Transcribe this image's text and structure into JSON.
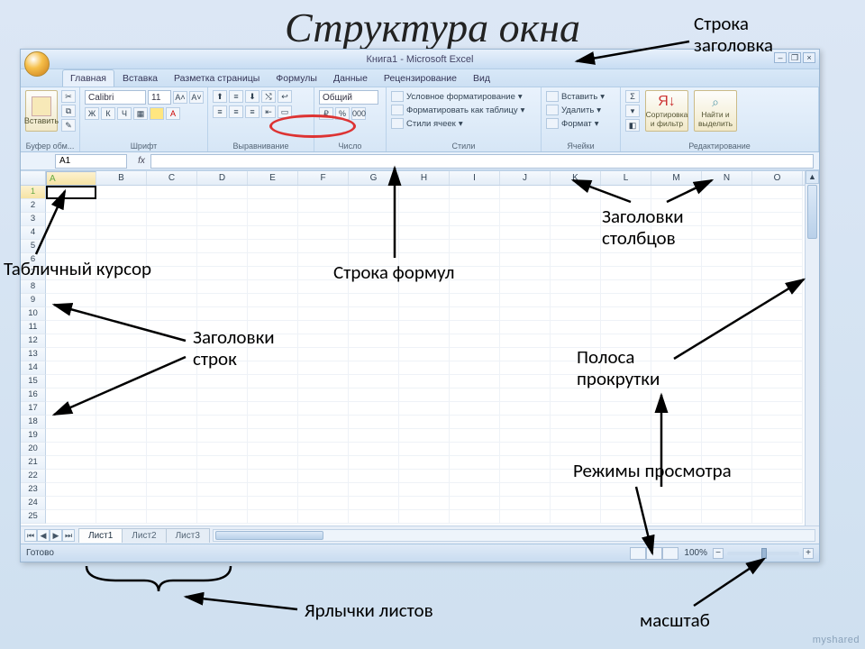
{
  "slide": {
    "title": "Структура окна"
  },
  "window_title": "Книга1 - Microsoft Excel",
  "tabs": {
    "home": "Главная",
    "insert": "Вставка",
    "layout": "Разметка страницы",
    "formulas": "Формулы",
    "data": "Данные",
    "review": "Рецензирование",
    "view": "Вид"
  },
  "ribbon": {
    "paste": "Вставить",
    "clipboard_group": "Буфер обм...",
    "font_name": "Calibri",
    "font_size": "11",
    "font_group": "Шрифт",
    "align_group": "Выравнивание",
    "number_fmt": "Общий",
    "number_group": "Число",
    "cond_fmt": "Условное форматирование",
    "fmt_table": "Форматировать как таблицу",
    "cell_styles": "Стили ячеек",
    "styles_group": "Стили",
    "ins": "Вставить",
    "del": "Удалить",
    "fmt": "Формат",
    "cells_group": "Ячейки",
    "sort": "Сортировка\nи фильтр",
    "find": "Найти и\nвыделить",
    "edit_group": "Редактирование",
    "b": "Ж",
    "i": "К",
    "u": "Ч"
  },
  "namebox": "A1",
  "fx": "fx",
  "columns": [
    "A",
    "B",
    "C",
    "D",
    "E",
    "F",
    "G",
    "H",
    "I",
    "J",
    "K",
    "L",
    "M",
    "N",
    "O"
  ],
  "rows": [
    "1",
    "2",
    "3",
    "4",
    "5",
    "6",
    "7",
    "8",
    "9",
    "10",
    "11",
    "12",
    "13",
    "14",
    "15",
    "16",
    "17",
    "18",
    "19",
    "20",
    "21",
    "22",
    "23",
    "24",
    "25"
  ],
  "sheets": {
    "s1": "Лист1",
    "s2": "Лист2",
    "s3": "Лист3"
  },
  "status": {
    "ready": "Готово",
    "zoom": "100%"
  },
  "callouts": {
    "titlebar": "Строка\nзаголовка",
    "cursor": "Табличный курсор",
    "formula_bar": "Строка формул",
    "col_hdrs": "Заголовки\nстолбцов",
    "row_hdrs": "Заголовки\nстрок",
    "scrollbar": "Полоса\nпрокрутки",
    "view_modes": "Режимы просмотра",
    "sheet_tabs": "Ярлычки листов",
    "zoom": "масштаб"
  },
  "watermark": "myshared"
}
